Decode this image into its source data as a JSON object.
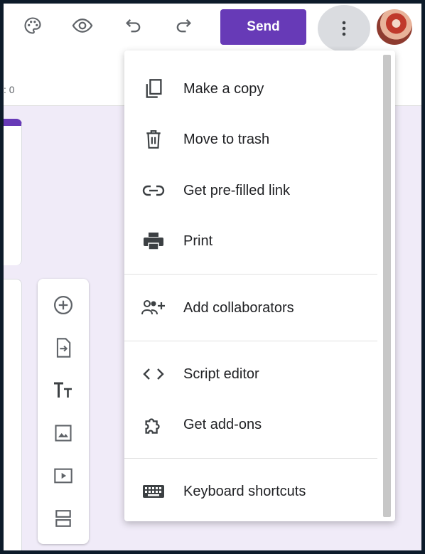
{
  "toolbar": {
    "send_label": "Send",
    "icons": [
      "palette-icon",
      "eye-icon",
      "undo-icon",
      "redo-icon",
      "more-vert-icon"
    ]
  },
  "subbar": {
    "responses_text": ": 0"
  },
  "menu": {
    "items": [
      {
        "label": "Make a copy",
        "icon": "copy-icon"
      },
      {
        "label": "Move to trash",
        "icon": "trash-icon"
      },
      {
        "label": "Get pre-filled link",
        "icon": "link-icon"
      },
      {
        "label": "Print",
        "icon": "print-icon"
      },
      {
        "label": "Add collaborators",
        "icon": "add-people-icon"
      },
      {
        "label": "Script editor",
        "icon": "code-icon"
      },
      {
        "label": "Get add-ons",
        "icon": "puzzle-icon"
      },
      {
        "label": "Keyboard shortcuts",
        "icon": "keyboard-icon"
      }
    ]
  },
  "side_toolbar": {
    "icons": [
      "add-question-icon",
      "import-questions-icon",
      "title-text-icon",
      "image-icon",
      "video-icon",
      "section-icon"
    ]
  },
  "colors": {
    "accent": "#673ab7",
    "menu_bg": "#ffffff",
    "page_bg": "#f0ebf8"
  }
}
